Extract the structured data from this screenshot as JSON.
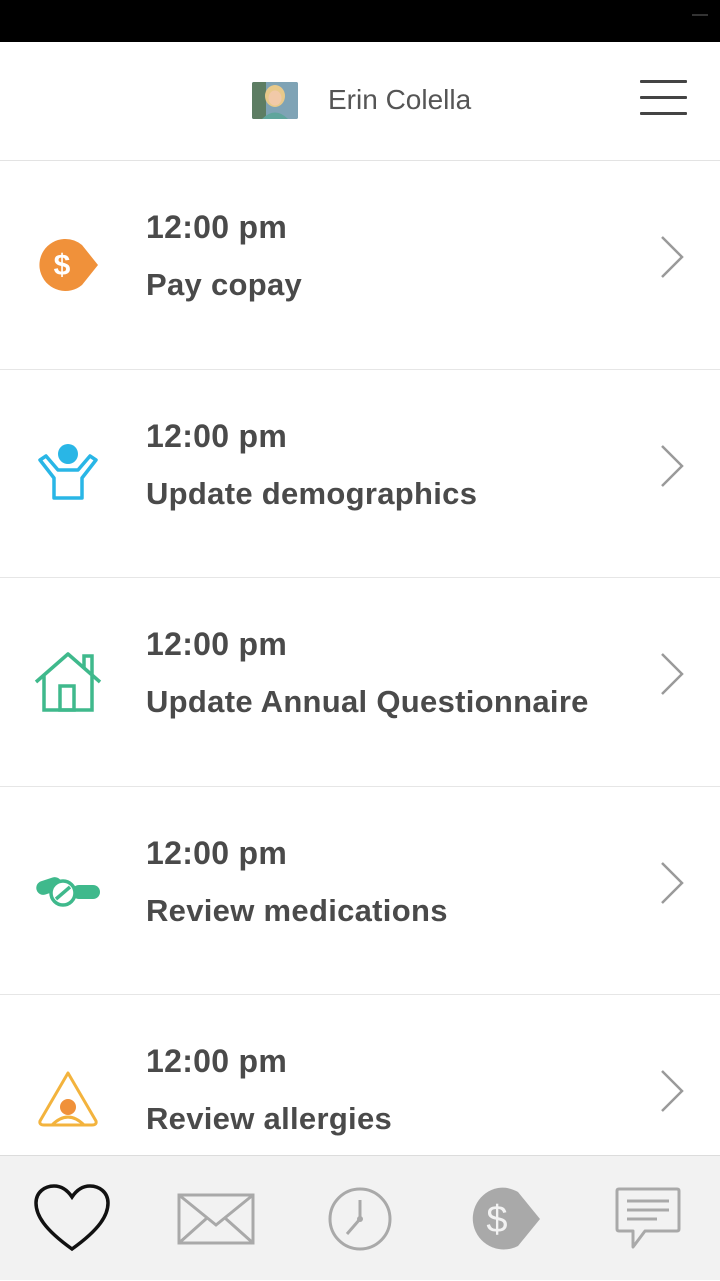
{
  "header": {
    "user_name": "Erin Colella",
    "avatar_icon": "user-avatar",
    "menu_icon": "hamburger-menu-icon"
  },
  "tasks": [
    {
      "time": "12:00 pm",
      "title": "Pay copay",
      "icon": "dollar-tag-icon",
      "color": "#f0913a"
    },
    {
      "time": "12:00 pm",
      "title": "Update demographics",
      "icon": "person-icon",
      "color": "#29b6e6"
    },
    {
      "time": "12:00 pm",
      "title": "Update Annual Questionnaire",
      "icon": "house-icon",
      "color": "#3fb98c"
    },
    {
      "time": "12:00 pm",
      "title": "Review medications",
      "icon": "pills-icon",
      "color": "#3fb98c"
    },
    {
      "time": "12:00 pm",
      "title": "Review allergies",
      "icon": "warning-icon",
      "color": "#f3b33d"
    }
  ],
  "tab_bar": {
    "tabs": [
      {
        "icon": "heart-icon",
        "active": true
      },
      {
        "icon": "mail-icon",
        "active": false
      },
      {
        "icon": "clock-icon",
        "active": false
      },
      {
        "icon": "dollar-tag-icon",
        "active": false
      },
      {
        "icon": "chat-icon",
        "active": false
      }
    ],
    "active_color": "#111111",
    "inactive_color": "#a9a9a9"
  }
}
